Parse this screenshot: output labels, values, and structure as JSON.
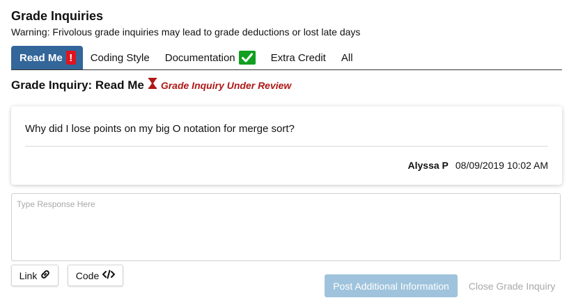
{
  "header": {
    "title": "Grade Inquiries",
    "warning": "Warning: Frivolous grade inquiries may lead to grade deductions or lost late days"
  },
  "tabs": [
    {
      "label": "Read Me",
      "active": true,
      "badge": "!",
      "badge_color": "#e0141e"
    },
    {
      "label": "Coding Style",
      "active": false
    },
    {
      "label": "Documentation",
      "active": false,
      "badge_icon": "checkmark-icon",
      "badge_color": "#12a020"
    },
    {
      "label": "Extra Credit",
      "active": false
    },
    {
      "label": "All",
      "active": false
    }
  ],
  "inquiry": {
    "heading": "Grade Inquiry: Read Me",
    "status_icon": "hourglass-icon",
    "status": "Grade Inquiry Under Review",
    "status_color": "#b01818"
  },
  "post": {
    "message": "Why did I lose points on my big O notation for merge sort?",
    "author": "Alyssa P",
    "timestamp": "08/09/2019 10:02 AM"
  },
  "response": {
    "placeholder": "Type Response Here",
    "value": ""
  },
  "buttons": {
    "link_label": "Link",
    "link_icon": "link-icon",
    "code_label": "Code",
    "code_icon": "code-icon",
    "post_label": "Post Additional Information",
    "close_label": "Close Grade Inquiry"
  },
  "colors": {
    "active_tab": "#336699",
    "post_button_disabled": "#9fc3dc"
  }
}
